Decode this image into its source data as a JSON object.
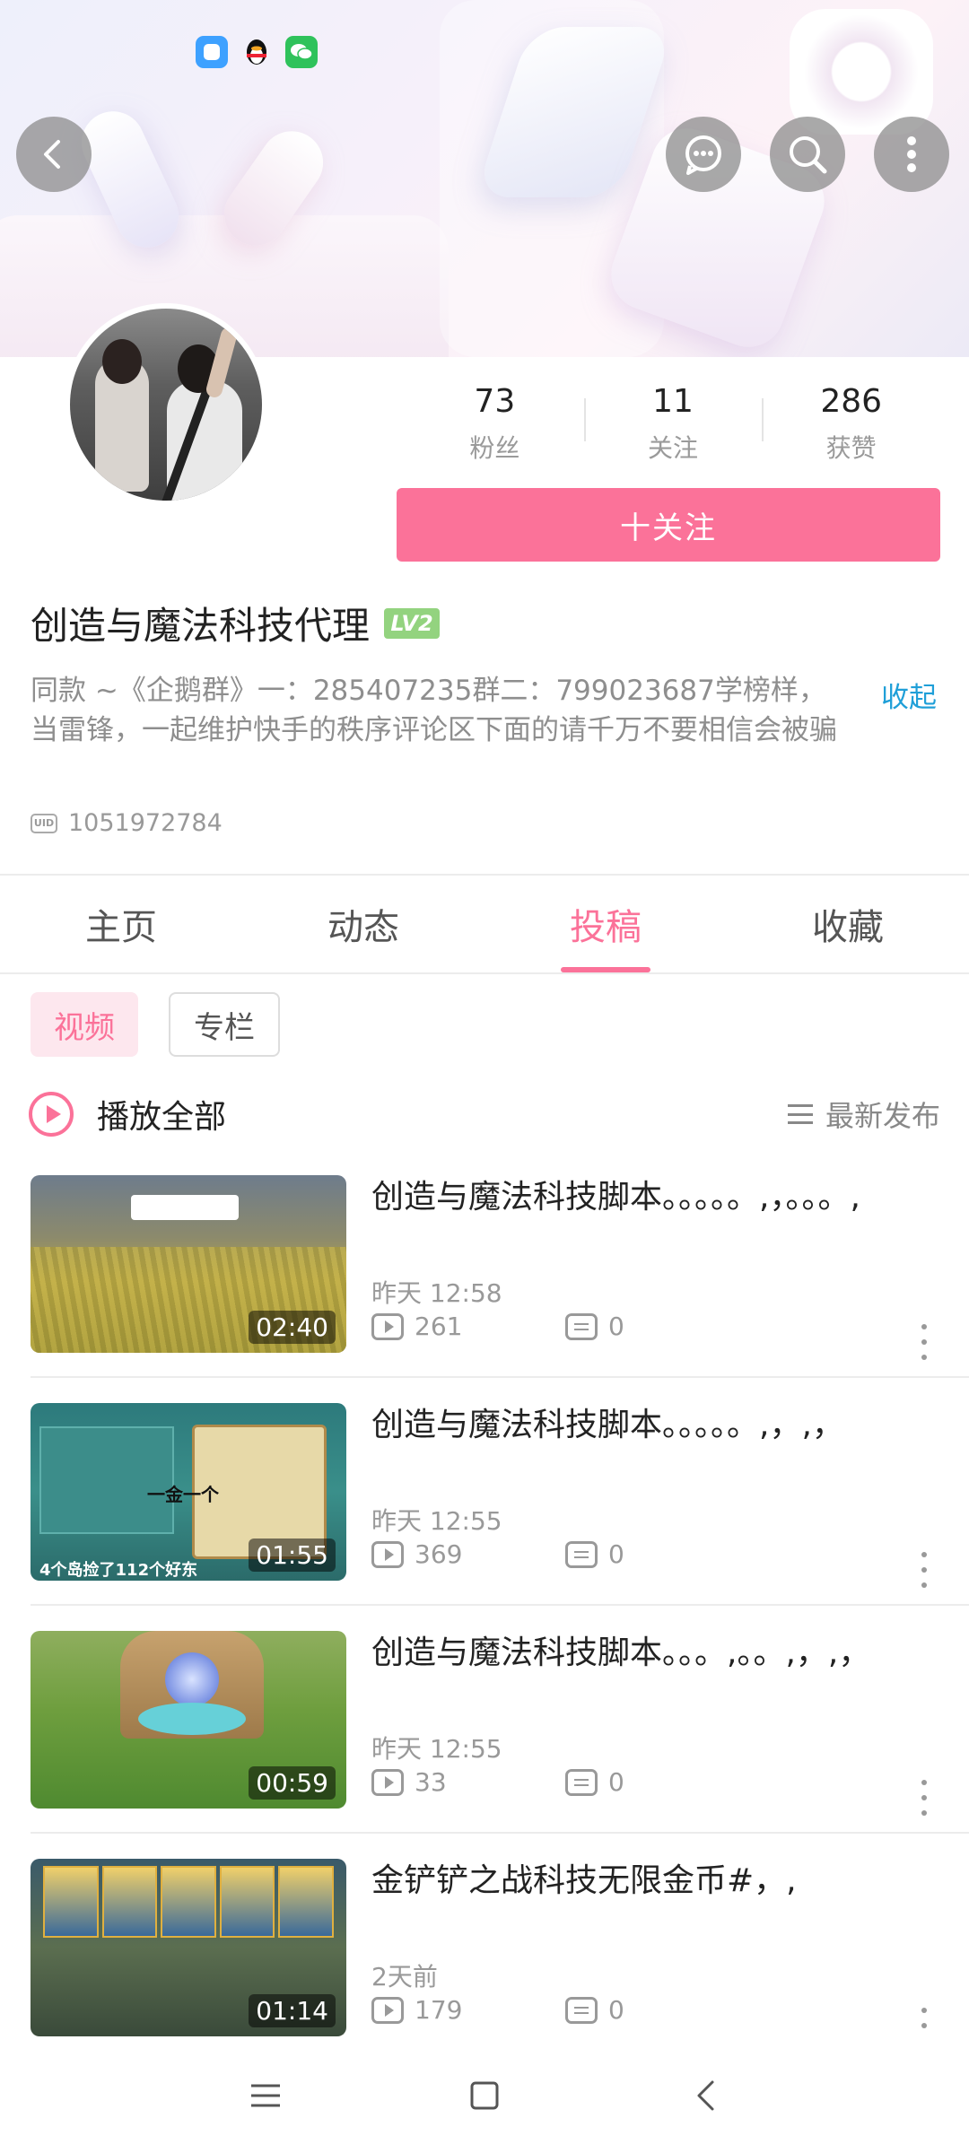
{
  "profile": {
    "followers_count": "73",
    "followers_label": "粉丝",
    "following_count": "11",
    "following_label": "关注",
    "likes_count": "286",
    "likes_label": "获赞",
    "follow_button": "十关注",
    "username": "创造与魔法科技代理",
    "level_badge": "LV2",
    "bio": "同款 ~《企鹅群》一：285407235群二：799023687学榜样，当雷锋，一起维护快手的秩序评论区下面的请千万不要相信会被骗",
    "collapse_label": "收起",
    "uid_icon_text": "UID",
    "uid": "1051972784"
  },
  "tabs": [
    "主页",
    "动态",
    "投稿",
    "收藏"
  ],
  "subtabs": [
    "视频",
    "专栏"
  ],
  "play_all_label": "播放全部",
  "sort_label": "最新发布",
  "videos": [
    {
      "title": "创造与魔法科技脚本。。。。。,，。。。,",
      "duration": "02:40",
      "time": "昨天 12:58",
      "views": "261",
      "comments": "0"
    },
    {
      "title": "创造与魔法科技脚本。。。。。,，,，",
      "duration": "01:55",
      "time": "昨天 12:55",
      "views": "369",
      "comments": "0"
    },
    {
      "title": "创造与魔法科技脚本。。。,。。,，,，",
      "duration": "00:59",
      "time": "昨天 12:55",
      "views": "33",
      "comments": "0"
    },
    {
      "title": "金铲铲之战科技无限金币#，,",
      "duration": "01:14",
      "time": "2天前",
      "views": "179",
      "comments": "0"
    }
  ],
  "colors": {
    "accent": "#fb7299",
    "link": "#1f9fd8",
    "level": "#93d37f"
  }
}
